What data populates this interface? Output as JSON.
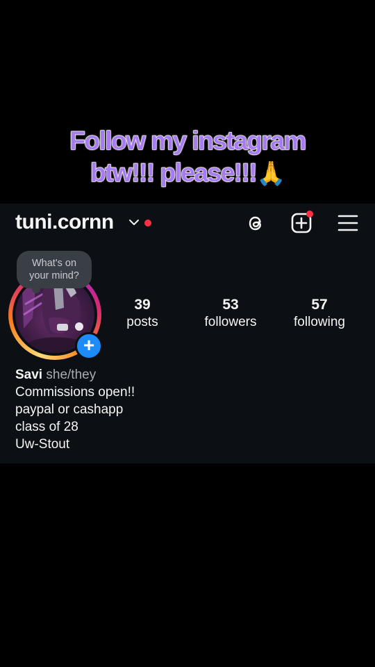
{
  "caption": {
    "line1": "Follow my instagram",
    "line2": "btw!!! please!!!",
    "emoji": "🙏"
  },
  "profile": {
    "username": "tuni.cornn",
    "note": {
      "line1": "What's on",
      "line2": "your mind?"
    },
    "stats": [
      {
        "value": "39",
        "label": "posts"
      },
      {
        "value": "53",
        "label": "followers"
      },
      {
        "value": "57",
        "label": "following"
      }
    ],
    "name": "Savi",
    "pronouns": "she/they",
    "bio_lines": [
      "Commissions open!!",
      "paypal or cashapp",
      "class of 28",
      "Uw-Stout"
    ]
  },
  "icons": {
    "username_dropdown": "chevron-down-icon",
    "threads": "threads-icon",
    "create": "create-post-icon",
    "menu": "hamburger-menu-icon",
    "add_story": "plus-icon"
  },
  "colors": {
    "caption_fill": "#a77cf0",
    "screen_bg": "#0c1014",
    "notification_dot": "#ff3040",
    "add_badge": "#1d8cf8",
    "note_bubble": "#3a3f45"
  }
}
